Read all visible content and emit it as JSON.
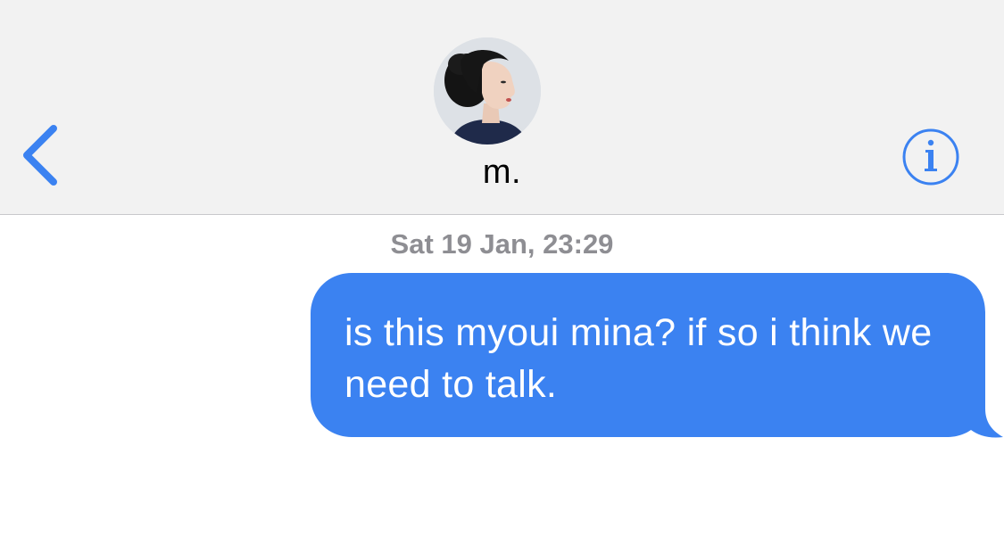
{
  "header": {
    "contact_name": "m.",
    "back_icon": "chevron-left-icon",
    "info_icon": "info-circle-icon",
    "accent_color": "#3b82f1"
  },
  "thread": {
    "timestamp": "Sat 19 Jan, 23:29",
    "messages": [
      {
        "direction": "outgoing",
        "text": "is this myoui mina? if so i think we need to talk.",
        "bubble_color": "#3b82f1"
      }
    ]
  }
}
